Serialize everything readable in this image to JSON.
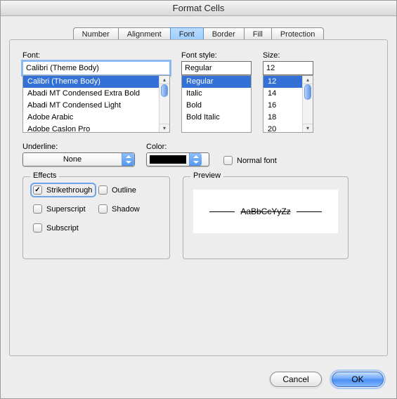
{
  "window": {
    "title": "Format Cells"
  },
  "tabs": {
    "number": "Number",
    "alignment": "Alignment",
    "font": "Font",
    "border": "Border",
    "fill": "Fill",
    "protection": "Protection"
  },
  "labels": {
    "font": "Font:",
    "font_style": "Font style:",
    "size": "Size:",
    "underline": "Underline:",
    "color": "Color:",
    "effects": "Effects",
    "preview": "Preview"
  },
  "font": {
    "value": "Calibri (Theme Body)",
    "list": [
      "Calibri (Theme Body)",
      "Abadi MT Condensed Extra Bold",
      "Abadi MT Condensed Light",
      "Adobe Arabic",
      "Adobe Caslon Pro"
    ]
  },
  "font_style": {
    "value": "Regular",
    "list": [
      "Regular",
      "Italic",
      "Bold",
      "Bold Italic"
    ]
  },
  "size": {
    "value": "12",
    "list": [
      "12",
      "14",
      "16",
      "18",
      "20"
    ]
  },
  "underline": {
    "value": "None"
  },
  "color": {
    "value": "#000000"
  },
  "normal_font": {
    "label": "Normal font",
    "checked": false
  },
  "effects": {
    "strikethrough": {
      "label": "Strikethrough",
      "checked": true
    },
    "outline": {
      "label": "Outline",
      "checked": false
    },
    "superscript": {
      "label": "Superscript",
      "checked": false
    },
    "shadow": {
      "label": "Shadow",
      "checked": false
    },
    "subscript": {
      "label": "Subscript",
      "checked": false
    }
  },
  "preview": {
    "text": "AaBbCcYyZz"
  },
  "buttons": {
    "cancel": "Cancel",
    "ok": "OK"
  }
}
